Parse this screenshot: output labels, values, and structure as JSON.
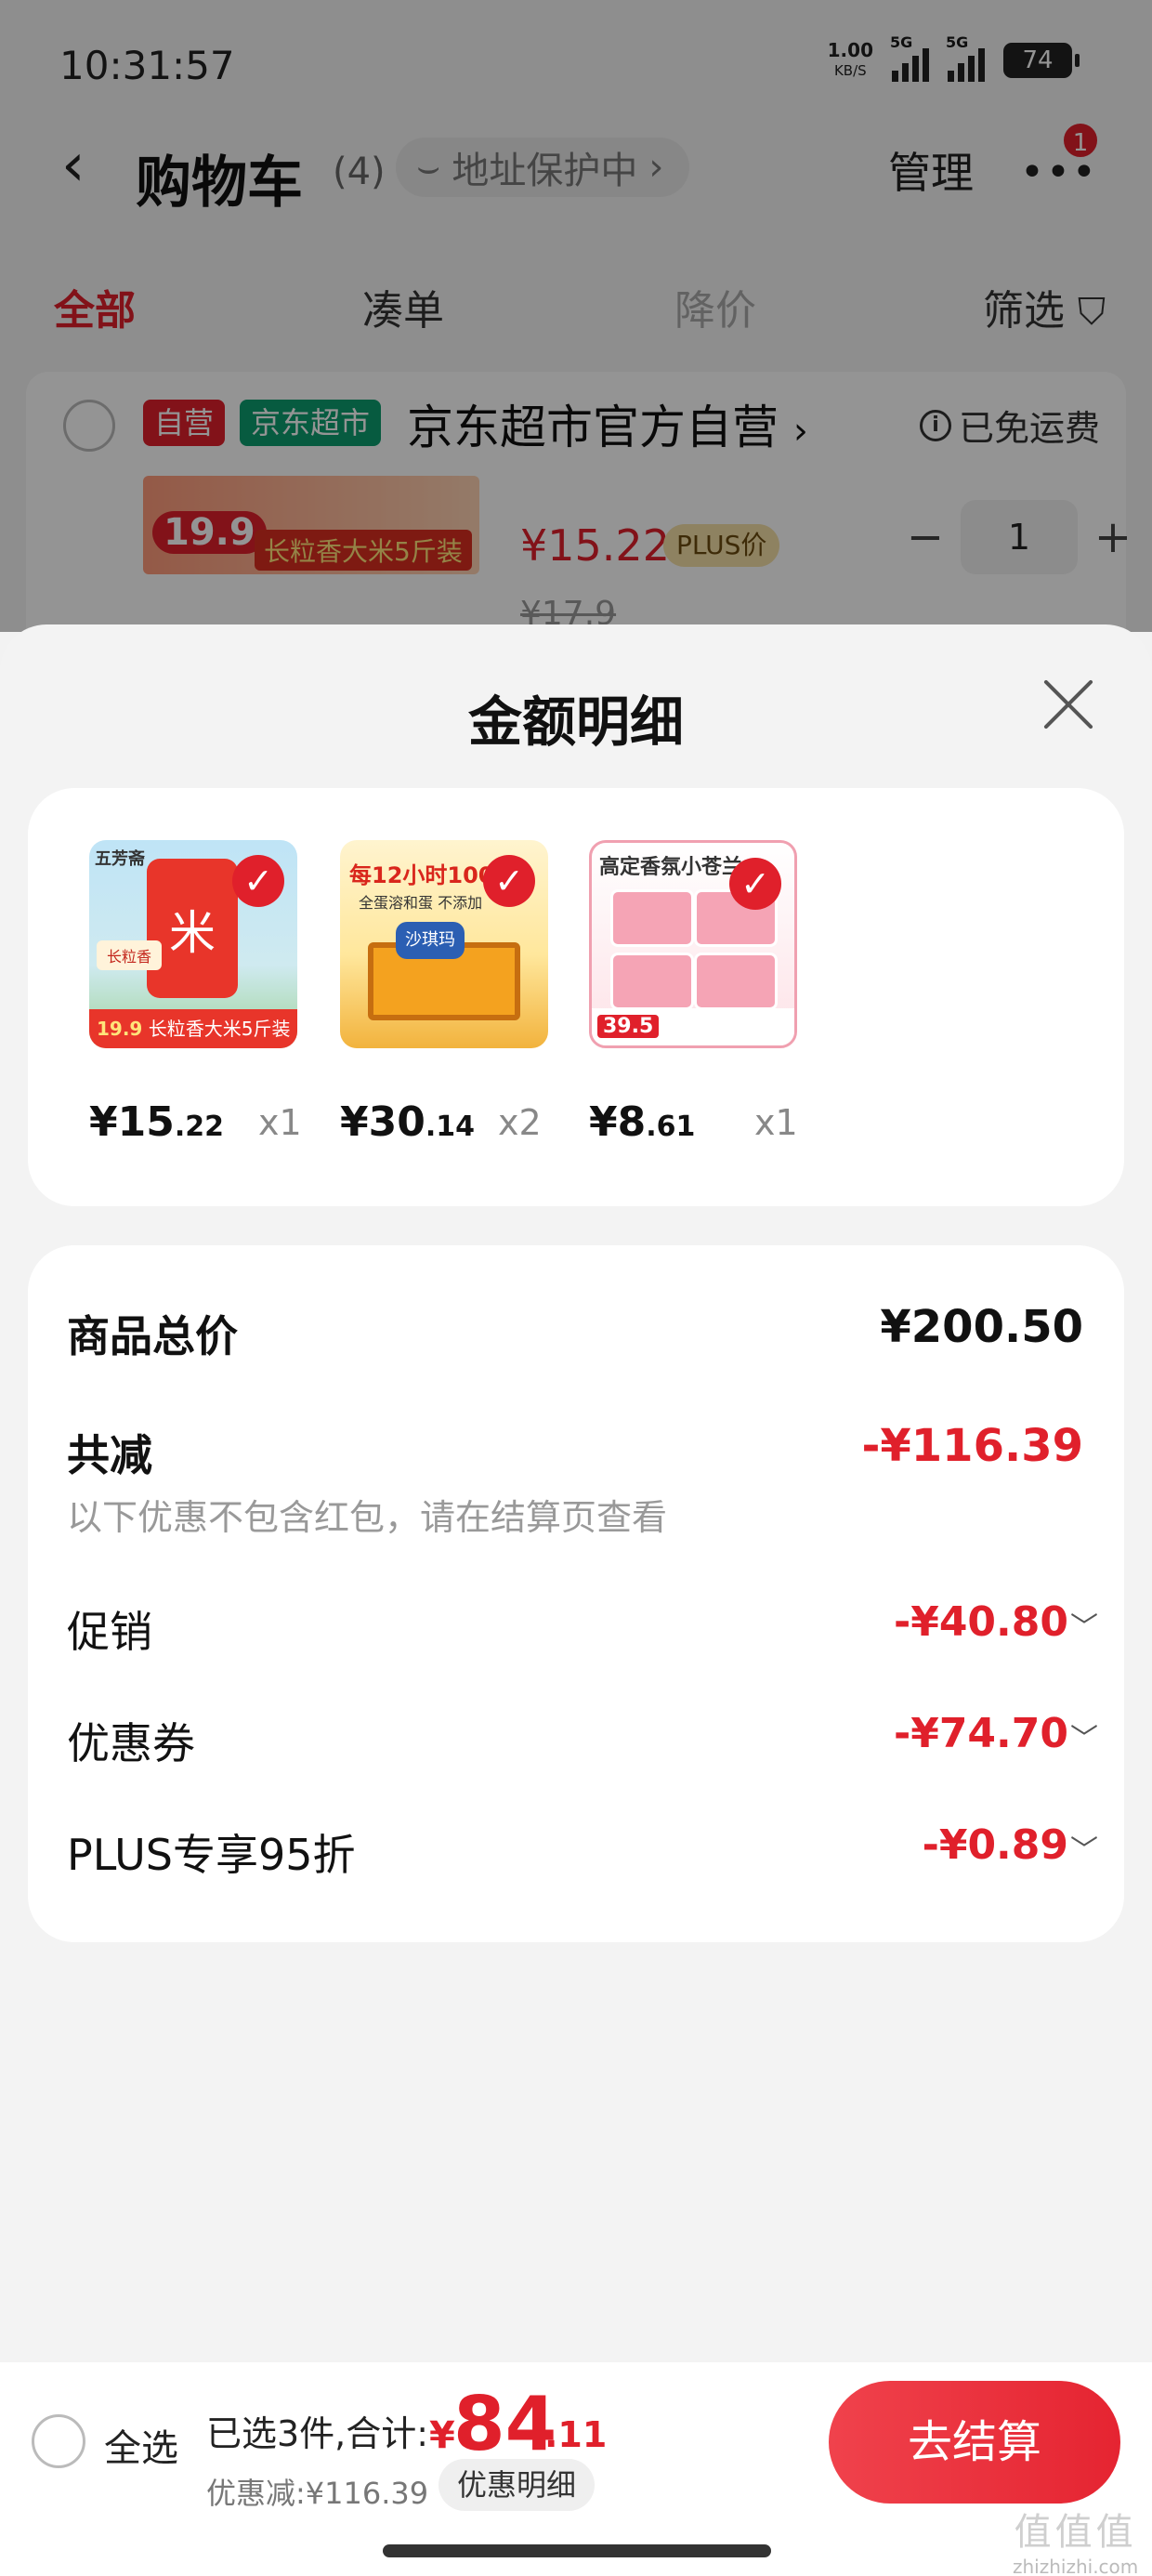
{
  "status_bar": {
    "time": "10:31:57",
    "net_speed": "1.00",
    "net_unit": "KB/S",
    "signal_tag": "5G",
    "battery": "74"
  },
  "nav": {
    "title": "购物车",
    "count": "(4)",
    "address_protection": "地址保护中",
    "manage": "管理",
    "notification_count": "1"
  },
  "filter_tabs": [
    {
      "label": "全部",
      "state": "active"
    },
    {
      "label": "凑单",
      "state": "normal"
    },
    {
      "label": "降价",
      "state": "dim"
    },
    {
      "label": "筛选",
      "state": "normal"
    }
  ],
  "store": {
    "badge_self": "自营",
    "badge_market": "京东超市",
    "name": "京东超市官方自营",
    "shipping": "已免运费",
    "item": {
      "thumb_price": "19.9",
      "thumb_text": "长粒香大米5斤装",
      "price": "¥15.22",
      "plus_tag": "PLUS价",
      "original_price": "¥17.9",
      "quantity": "1"
    }
  },
  "sheet": {
    "title": "金额明细",
    "selected_items": [
      {
        "name": "长粒香大米5斤装",
        "brand": "五芳斋",
        "price_int": "¥15",
        "price_dec": ".22",
        "qty": "x1",
        "thumb_price": "19.9",
        "thumb_label": "长粒香"
      },
      {
        "name": "沙琪玛",
        "headline": "每12小时100万",
        "price_int": "¥30",
        "price_dec": ".14",
        "qty": "x2",
        "sub": "全蛋溶和蛋 不添加",
        "logo": "沙琪玛"
      },
      {
        "name": "高定香氛小苍兰",
        "headline": "高定香氛小苍兰",
        "price_int": "¥8",
        "price_dec": ".61",
        "qty": "x1",
        "price_tag": "39.5"
      }
    ],
    "summary": {
      "total_label": "商品总价",
      "total_value": "¥200.50",
      "reduce_label": "共减",
      "reduce_value": "-¥116.39",
      "note": "以下优惠不包含红包，请在结算页查看",
      "lines": [
        {
          "label": "促销",
          "value": "-¥40.80"
        },
        {
          "label": "优惠券",
          "value": "-¥74.70"
        },
        {
          "label": "PLUS专享95折",
          "value": "-¥0.89"
        }
      ]
    }
  },
  "bottom_bar": {
    "select_all": "全选",
    "selected_info": "已选3件,合计:",
    "currency": "¥",
    "total_int": "84",
    "total_dec": ".11",
    "discount_info": "优惠减:¥116.39",
    "detail_button": "优惠明细",
    "checkout": "去结算"
  },
  "watermark": {
    "top": "值值值",
    "bottom": "zhizhizhi.com"
  },
  "colors": {
    "accent": "#e0202b",
    "market_green": "#0d9e6e",
    "plus_gold": "#f5e0a8"
  }
}
